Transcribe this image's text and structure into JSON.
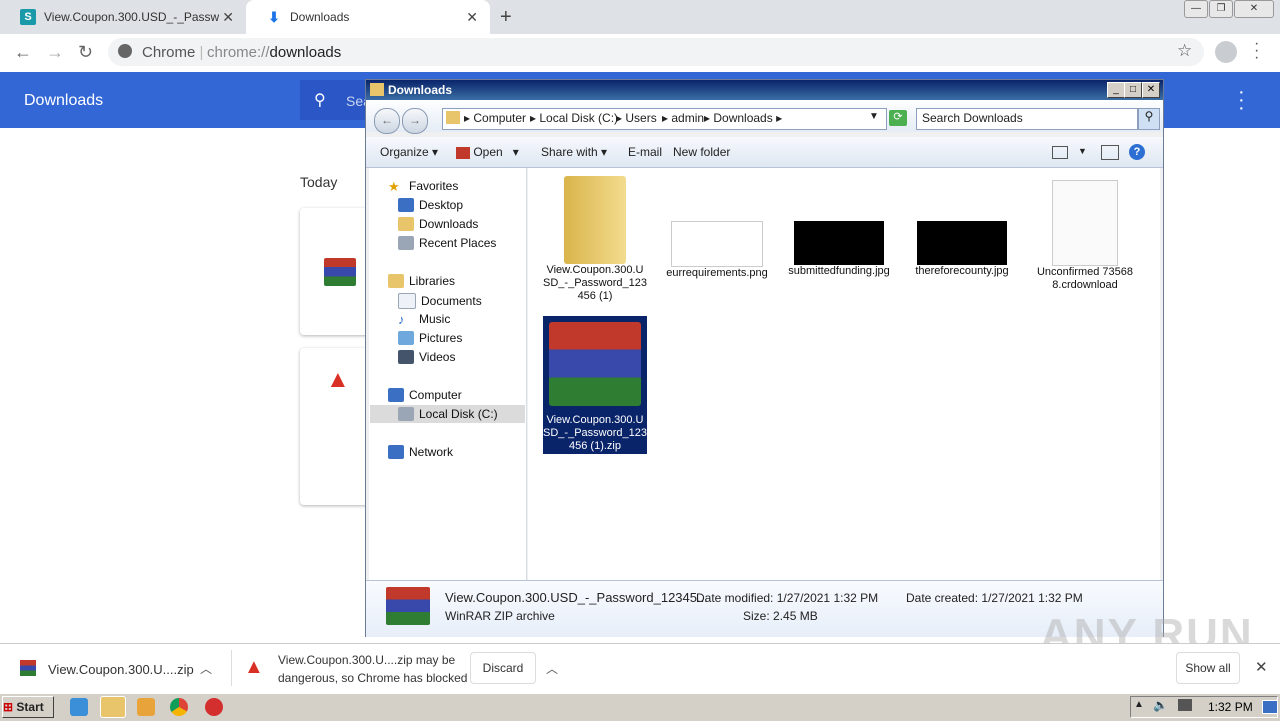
{
  "browser": {
    "tabs": [
      {
        "title": "View.Coupon.300.USD_-_Password..."
      },
      {
        "title": "Downloads"
      }
    ],
    "omnibox": {
      "site": "Chrome",
      "scheme": "chrome://",
      "path": "downloads"
    }
  },
  "downloads_page": {
    "title": "Downloads",
    "search_placeholder": "Sea",
    "section": "Today"
  },
  "explorer": {
    "title": "Downloads",
    "breadcrumb": [
      "Computer",
      "Local Disk (C:)",
      "Users",
      "admin",
      "Downloads"
    ],
    "search_placeholder": "Search Downloads",
    "commands": {
      "organize": "Organize",
      "open": "Open",
      "share": "Share with",
      "email": "E-mail",
      "new_folder": "New folder"
    },
    "nav": {
      "favorites": "Favorites",
      "desktop": "Desktop",
      "downloads": "Downloads",
      "recent": "Recent Places",
      "libraries": "Libraries",
      "documents": "Documents",
      "music": "Music",
      "pictures": "Pictures",
      "videos": "Videos",
      "computer": "Computer",
      "local_disk": "Local Disk (C:)",
      "network": "Network"
    },
    "files": [
      {
        "name": "View.Coupon.300.USD_-_Password_123456 (1)"
      },
      {
        "name": "eurrequirements.png"
      },
      {
        "name": "submittedfunding.jpg"
      },
      {
        "name": "thereforecounty.jpg"
      },
      {
        "name": "Unconfirmed 735688.crdownload"
      },
      {
        "name": "View.Coupon.300.USD_-_Password_123456 (1).zip"
      }
    ],
    "details": {
      "name": "View.Coupon.300.USD_-_Password_12345...",
      "type": "WinRAR ZIP archive",
      "modified_label": "Date modified:",
      "modified": "1/27/2021 1:32 PM",
      "size_label": "Size:",
      "size": "2.45 MB",
      "created_label": "Date created:",
      "created": "1/27/2021 1:32 PM"
    }
  },
  "shelf": {
    "item1": "View.Coupon.300.U....zip",
    "item2_line1": "View.Coupon.300.U....zip may be",
    "item2_line2": "dangerous, so Chrome has blocked it.",
    "discard": "Discard",
    "show_all": "Show all"
  },
  "taskbar": {
    "start": "Start",
    "clock": "1:32 PM"
  },
  "watermark": "ANY RUN"
}
